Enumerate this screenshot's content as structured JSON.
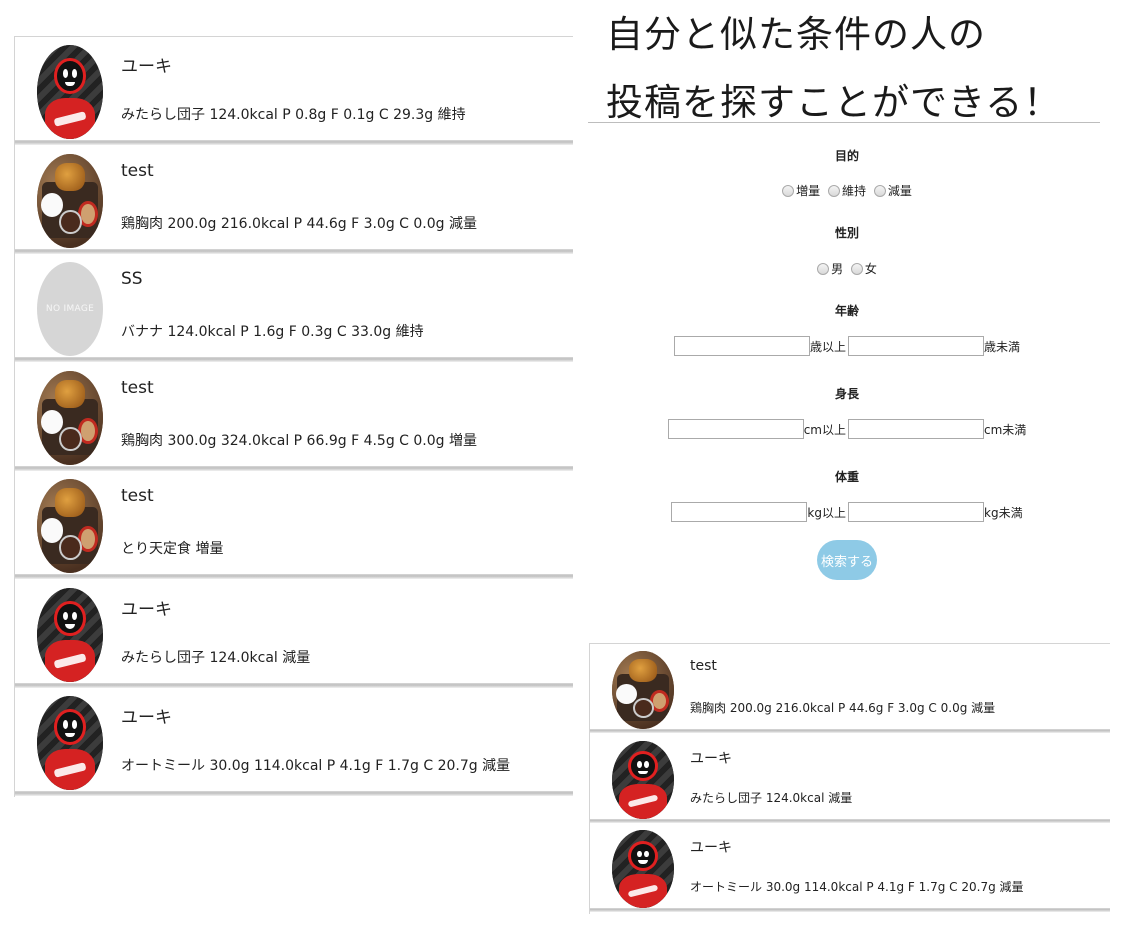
{
  "left_feed": {
    "posts": [
      {
        "name": "ユーキ",
        "text": "みたらし団子 124.0kcal P 0.8g F 0.1g C 29.3g 維持",
        "avatar": "yuki"
      },
      {
        "name": "test",
        "text": "鶏胸肉 200.0g 216.0kcal P 44.6g F 3.0g C 0.0g 減量",
        "avatar": "food"
      },
      {
        "name": "SS",
        "text": "バナナ 124.0kcal P 1.6g F 0.3g C 33.0g 維持",
        "avatar": "noimage"
      },
      {
        "name": "test",
        "text": "鶏胸肉 300.0g 324.0kcal P 66.9g F 4.5g C 0.0g 増量",
        "avatar": "food"
      },
      {
        "name": "test",
        "text": "とり天定食 増量",
        "avatar": "food"
      },
      {
        "name": "ユーキ",
        "text": "みたらし団子 124.0kcal 減量",
        "avatar": "yuki"
      },
      {
        "name": "ユーキ",
        "text": "オートミール 30.0g 114.0kcal P 4.1g F 1.7g C 20.7g 減量",
        "avatar": "yuki"
      }
    ]
  },
  "noimage_label": "NO IMAGE",
  "header": {
    "line1": "自分と似た条件の人の",
    "line2": "投稿を探すことができる！"
  },
  "search": {
    "purpose": {
      "label": "目的",
      "options": [
        "増量",
        "維持",
        "減量"
      ]
    },
    "gender": {
      "label": "性別",
      "options": [
        "男",
        "女"
      ]
    },
    "age": {
      "label": "年齢",
      "min_unit": "歳以上",
      "max_unit": "歳未満",
      "min_value": "",
      "max_value": ""
    },
    "height": {
      "label": "身長",
      "min_unit": "cm以上",
      "max_unit": "cm未満",
      "min_value": "",
      "max_value": ""
    },
    "weight": {
      "label": "体重",
      "min_unit": "kg以上",
      "max_unit": "kg未満",
      "min_value": "",
      "max_value": ""
    },
    "submit_label": "検索する"
  },
  "right_feed": {
    "posts": [
      {
        "name": "test",
        "text": "鶏胸肉 200.0g 216.0kcal P 44.6g F 3.0g C 0.0g 減量",
        "avatar": "food"
      },
      {
        "name": "ユーキ",
        "text": "みたらし団子 124.0kcal 減量",
        "avatar": "yuki"
      },
      {
        "name": "ユーキ",
        "text": "オートミール 30.0g 114.0kcal P 4.1g F 1.7g C 20.7g 減量",
        "avatar": "yuki"
      }
    ]
  },
  "colors": {
    "button_bg": "#8ecae6",
    "divider": "#bfbfbf"
  }
}
